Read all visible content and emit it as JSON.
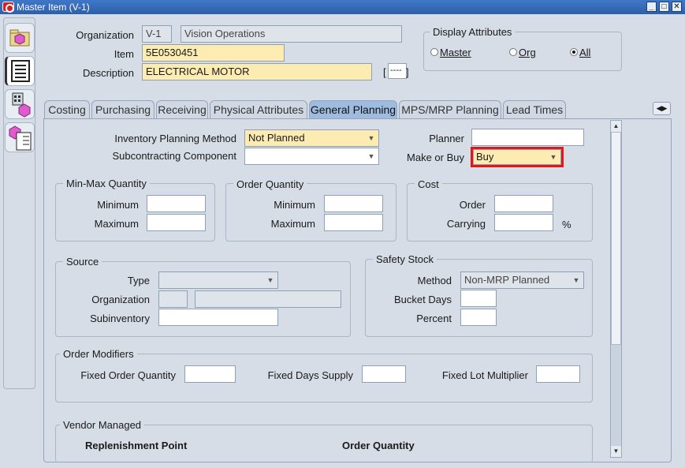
{
  "window": {
    "title": "Master Item (V-1)",
    "min": "_",
    "max": "□",
    "close": "✕"
  },
  "header": {
    "organization_label": "Organization",
    "organization_code": "V-1",
    "organization_name": "Vision Operations",
    "item_label": "Item",
    "item_value": "5E0530451",
    "description_label": "Description",
    "description_value": "ELECTRICAL MOTOR",
    "dff_bracket_open": "[",
    "dff_value": "----",
    "dff_bracket_close": "]"
  },
  "display_attributes": {
    "title": "Display Attributes",
    "options": [
      {
        "label": "Master",
        "selected": false
      },
      {
        "label": "Org",
        "selected": false
      },
      {
        "label": "All",
        "selected": true
      }
    ]
  },
  "tabs": [
    {
      "label": "Costing",
      "active": false
    },
    {
      "label": "Purchasing",
      "active": false
    },
    {
      "label": "Receiving",
      "active": false
    },
    {
      "label": "Physical Attributes",
      "active": false
    },
    {
      "label": "General Planning",
      "active": true
    },
    {
      "label": "MPS/MRP Planning",
      "active": false
    },
    {
      "label": "Lead Times",
      "active": false
    }
  ],
  "nav_icon": "tab-navigate-icon",
  "planning": {
    "inv_method_label": "Inventory Planning Method",
    "inv_method_value": "Not Planned",
    "subcontracting_label": "Subcontracting Component",
    "subcontracting_value": "",
    "planner_label": "Planner",
    "planner_value": "",
    "make_buy_label": "Make or Buy",
    "make_buy_value": "Buy"
  },
  "minmax": {
    "title": "Min-Max Quantity",
    "minimum_label": "Minimum",
    "maximum_label": "Maximum"
  },
  "order_qty": {
    "title": "Order Quantity",
    "minimum_label": "Minimum",
    "maximum_label": "Maximum"
  },
  "cost": {
    "title": "Cost",
    "order_label": "Order",
    "carrying_label": "Carrying",
    "percent": "%"
  },
  "source": {
    "title": "Source",
    "type_label": "Type",
    "organization_label": "Organization",
    "subinventory_label": "Subinventory"
  },
  "safety_stock": {
    "title": "Safety Stock",
    "method_label": "Method",
    "method_value": "Non-MRP Planned",
    "bucket_days_label": "Bucket Days",
    "percent_label": "Percent"
  },
  "order_modifiers": {
    "title": "Order Modifiers",
    "fixed_order_qty_label": "Fixed Order Quantity",
    "fixed_days_supply_label": "Fixed Days Supply",
    "fixed_lot_mult_label": "Fixed Lot Multiplier"
  },
  "vendor_managed": {
    "title": "Vendor Managed",
    "replenishment_label": "Replenishment Point",
    "order_quantity_label": "Order Quantity"
  },
  "colors": {
    "required": "#fcecb1",
    "active_tab": "#9ebce0",
    "highlight": "#e01818"
  }
}
